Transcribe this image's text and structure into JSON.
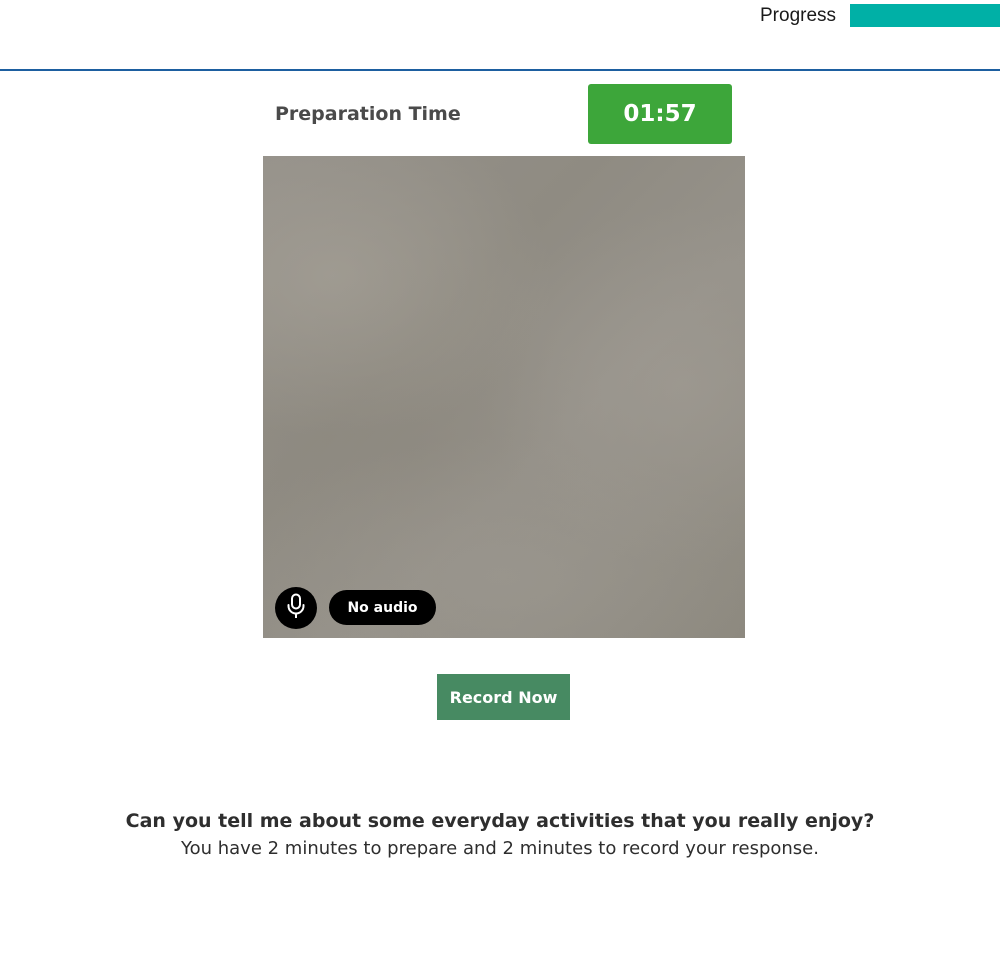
{
  "header": {
    "progress_label": "Progress",
    "progress_fraction": 1.0,
    "progress_color": "#00b0a6",
    "divider_color": "#1d5fa0"
  },
  "preparation": {
    "label": "Preparation Time",
    "timer": "01:57",
    "timer_color": "#3da63a"
  },
  "camera": {
    "mic_icon": "microphone-icon",
    "audio_status": "No audio"
  },
  "actions": {
    "record_label": "Record Now",
    "record_color": "#478a62"
  },
  "prompt": {
    "question": "Can you tell me about some everyday activities that you really enjoy?",
    "instructions": "You have 2 minutes to prepare and 2 minutes to record your response."
  }
}
